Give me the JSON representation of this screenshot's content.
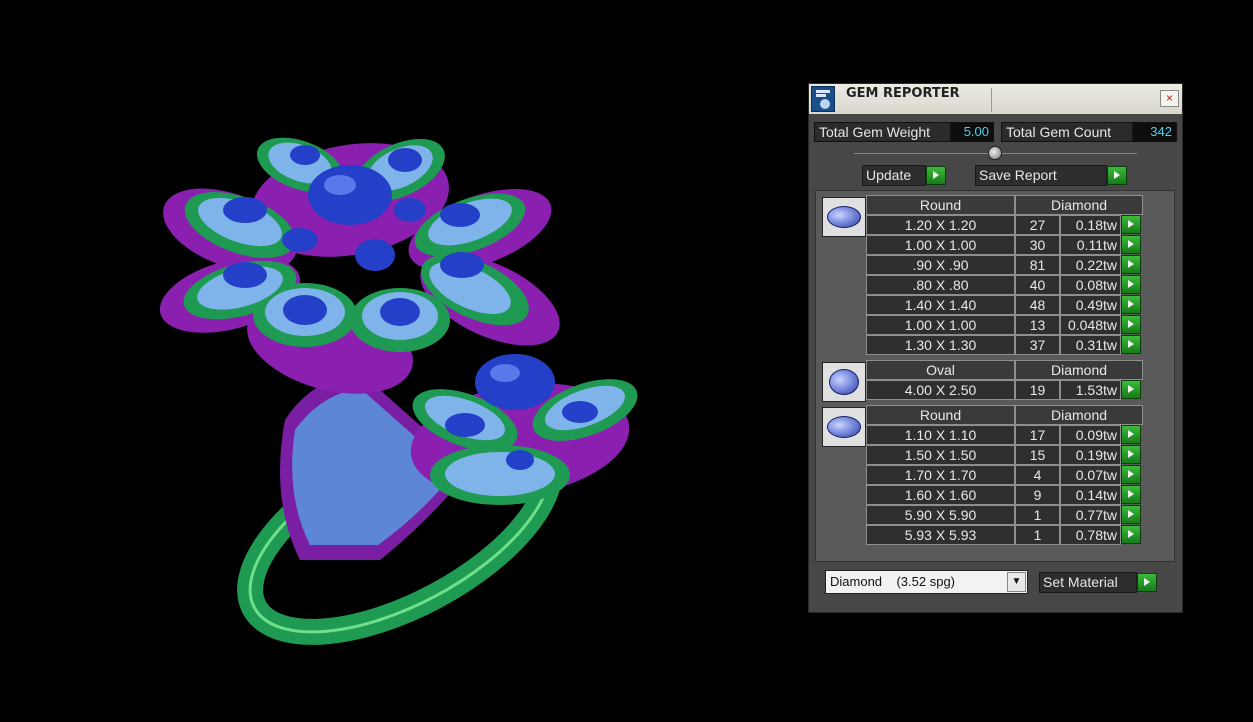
{
  "colors": {
    "background": "#000000",
    "panel": "#474747",
    "accent_value": "#4ed0ee",
    "button_green": "#2aa52a",
    "metal_green": "#1f9a52",
    "metal_purple": "#8a1fb0",
    "gem_blue": "#2440c8",
    "melee_blue": "#7fb4ea"
  },
  "viewport": {
    "description_icon": "3d-ring-model"
  },
  "panel": {
    "title": "GEM REPORTER",
    "close_icon": "×",
    "total_gem_weight_label": "Total Gem Weight",
    "total_gem_weight_value": "5.00",
    "total_gem_count_label": "Total Gem Count",
    "total_gem_count_value": "342",
    "update_label": "Update",
    "save_report_label": "Save Report",
    "groups": [
      {
        "shape": "Round",
        "material": "Diamond",
        "rows": [
          {
            "size": "1.20 X 1.20",
            "count": "27",
            "weight": "0.18tw"
          },
          {
            "size": "1.00 X 1.00",
            "count": "30",
            "weight": "0.11tw"
          },
          {
            "size": ".90 X .90",
            "count": "81",
            "weight": "0.22tw"
          },
          {
            "size": ".80 X .80",
            "count": "40",
            "weight": "0.08tw"
          },
          {
            "size": "1.40 X 1.40",
            "count": "48",
            "weight": "0.49tw"
          },
          {
            "size": "1.00 X 1.00",
            "count": "13",
            "weight": "0.048tw"
          },
          {
            "size": "1.30 X 1.30",
            "count": "37",
            "weight": "0.31tw"
          }
        ]
      },
      {
        "shape": "Oval",
        "material": "Diamond",
        "rows": [
          {
            "size": "4.00 X 2.50",
            "count": "19",
            "weight": "1.53tw"
          }
        ]
      },
      {
        "shape": "Round",
        "material": "Diamond",
        "rows": [
          {
            "size": "1.10 X 1.10",
            "count": "17",
            "weight": "0.09tw"
          },
          {
            "size": "1.50 X 1.50",
            "count": "15",
            "weight": "0.19tw"
          },
          {
            "size": "1.70 X 1.70",
            "count": "4",
            "weight": "0.07tw"
          },
          {
            "size": "1.60 X 1.60",
            "count": "9",
            "weight": "0.14tw"
          },
          {
            "size": "5.90 X 5.90",
            "count": "1",
            "weight": "0.77tw"
          },
          {
            "size": "5.93 X 5.93",
            "count": "1",
            "weight": "0.78tw"
          }
        ]
      }
    ],
    "material_select": "Diamond    (3.52 spg)",
    "dropdown_arrow": "▼",
    "set_material_label": "Set Material"
  }
}
